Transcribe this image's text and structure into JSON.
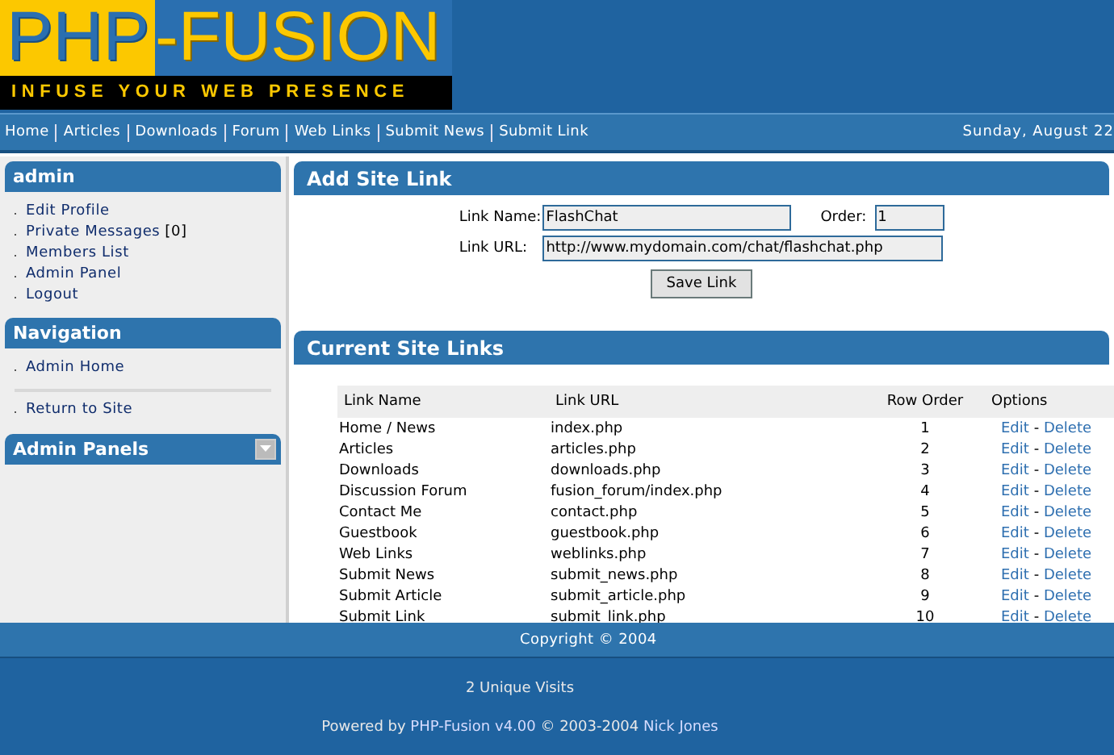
{
  "logo": {
    "title_left": "PHP",
    "title_right": "-FUSION",
    "tagline": "INFUSE YOUR WEB PRESENCE"
  },
  "nav": {
    "links": [
      "Home",
      "Articles",
      "Downloads",
      "Forum",
      "Web Links",
      "Submit News",
      "Submit Link"
    ],
    "date": "Sunday, August 22"
  },
  "sidebar": {
    "panels": [
      {
        "title": "admin",
        "items": [
          {
            "kind": "link",
            "label": "Edit Profile"
          },
          {
            "kind": "link",
            "label": "Private Messages",
            "count": "[0]"
          },
          {
            "kind": "link",
            "label": "Members List"
          },
          {
            "kind": "link",
            "label": "Admin Panel"
          },
          {
            "kind": "link",
            "label": "Logout"
          }
        ]
      },
      {
        "title": "Navigation",
        "items": [
          {
            "kind": "link",
            "label": "Admin Home"
          },
          {
            "kind": "divider"
          },
          {
            "kind": "link",
            "label": "Return to Site"
          }
        ]
      },
      {
        "title": "Admin Panels",
        "toggle": {
          "expanded": false
        }
      }
    ]
  },
  "add_link": {
    "title": "Add Site Link",
    "name_label": "Link Name:",
    "name_value": "FlashChat",
    "order_label": "Order:",
    "order_value": "1",
    "url_label": "Link URL:",
    "url_value": "http://www.mydomain.com/chat/flashchat.php",
    "button": "Save Link"
  },
  "links_table": {
    "title": "Current Site Links",
    "columns": [
      "Link Name",
      "Link URL",
      "Row Order",
      "Options"
    ],
    "rows": [
      {
        "name": "Home / News",
        "url": "index.php",
        "order": "1",
        "options": [
          "Edit",
          "Delete"
        ],
        "separator": "-"
      },
      {
        "name": "Articles",
        "url": "articles.php",
        "order": "2",
        "options": [
          "Edit",
          "Delete"
        ],
        "separator": "-"
      },
      {
        "name": "Downloads",
        "url": "downloads.php",
        "order": "3",
        "options": [
          "Edit",
          "Delete"
        ],
        "separator": "-"
      },
      {
        "name": "Discussion Forum",
        "url": "fusion_forum/index.php",
        "order": "4",
        "options": [
          "Edit",
          "Delete"
        ],
        "separator": "-"
      },
      {
        "name": "Contact Me",
        "url": "contact.php",
        "order": "5",
        "options": [
          "Edit",
          "Delete"
        ],
        "separator": "-"
      },
      {
        "name": "Guestbook",
        "url": "guestbook.php",
        "order": "6",
        "options": [
          "Edit",
          "Delete"
        ],
        "separator": "-"
      },
      {
        "name": "Web Links",
        "url": "weblinks.php",
        "order": "7",
        "options": [
          "Edit",
          "Delete"
        ],
        "separator": "-"
      },
      {
        "name": "Submit News",
        "url": "submit_news.php",
        "order": "8",
        "options": [
          "Edit",
          "Delete"
        ],
        "separator": "-"
      },
      {
        "name": "Submit Article",
        "url": "submit_article.php",
        "order": "9",
        "options": [
          "Edit",
          "Delete"
        ],
        "separator": "-"
      },
      {
        "name": "Submit Link",
        "url": "submit_link.php",
        "order": "10",
        "options": [
          "Edit",
          "Delete"
        ],
        "separator": "-"
      }
    ]
  },
  "footer": {
    "copyright": "Copyright © 2004",
    "visits": "2 Unique Visits",
    "powered": [
      {
        "text": "Powered by ",
        "link": false
      },
      {
        "text": "PHP-Fusion v4.00",
        "link": true
      },
      {
        "text": " © 2003-2004 ",
        "link": false
      },
      {
        "text": "Nick Jones",
        "link": true
      }
    ]
  }
}
